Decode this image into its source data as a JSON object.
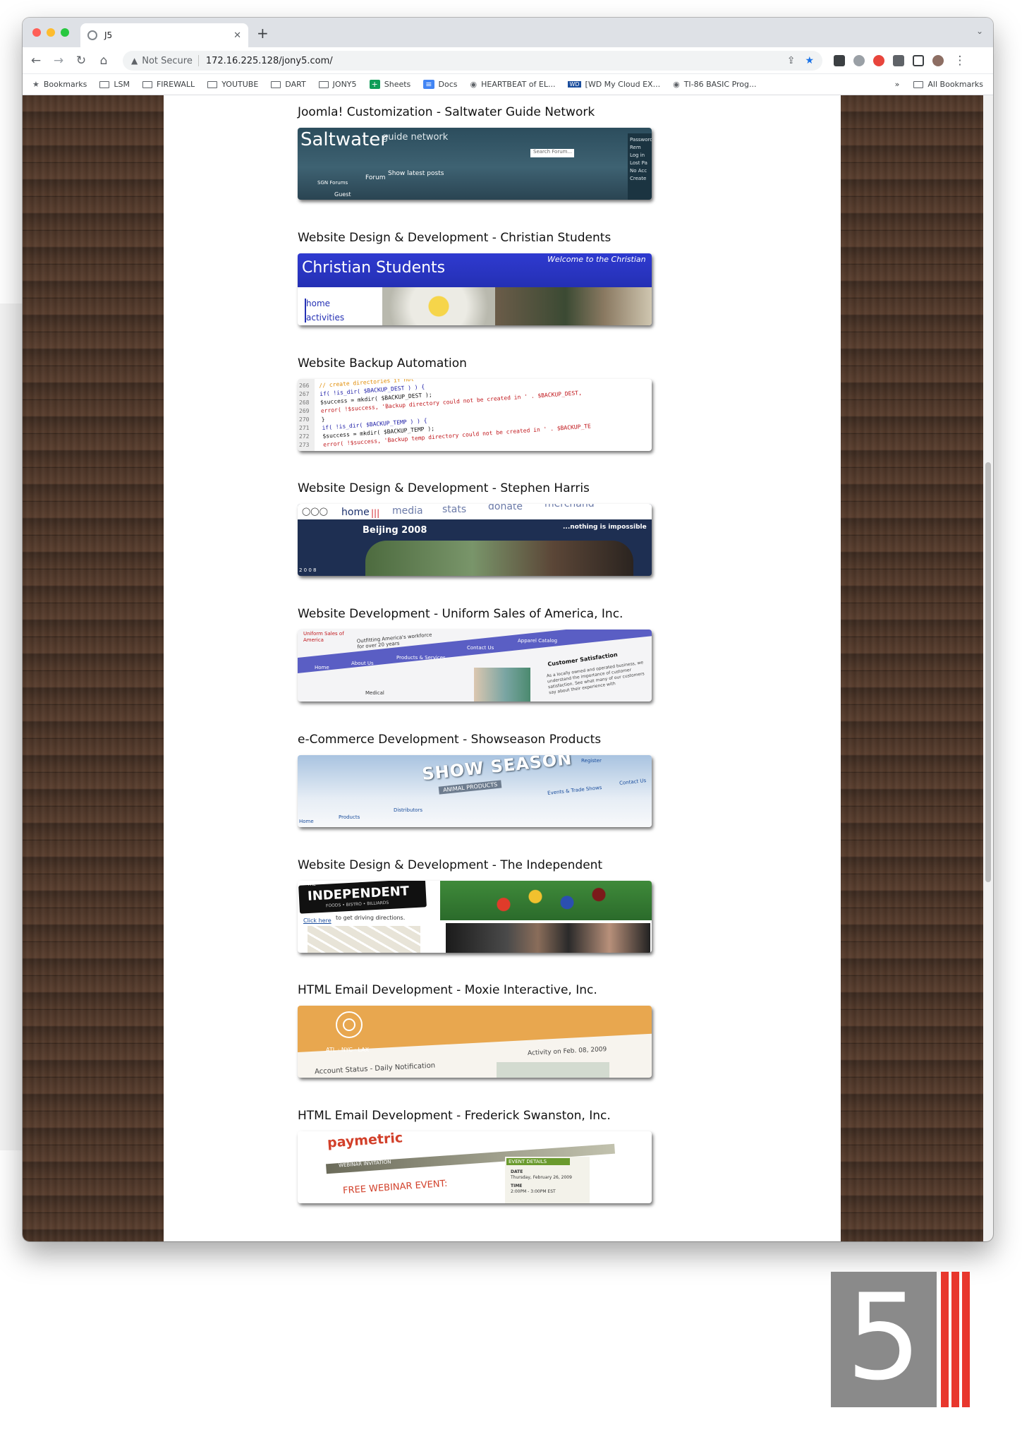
{
  "browser": {
    "tab_title": "J5",
    "security_label": "Not Secure",
    "url": "172.16.225.128/jony5.com/",
    "bookmarks": [
      {
        "label": "Bookmarks",
        "icon": "star-icon"
      },
      {
        "label": "LSM",
        "icon": "folder-icon"
      },
      {
        "label": "FIREWALL",
        "icon": "folder-icon"
      },
      {
        "label": "YOUTUBE",
        "icon": "folder-icon"
      },
      {
        "label": "DART",
        "icon": "folder-icon"
      },
      {
        "label": "JONY5",
        "icon": "folder-icon"
      },
      {
        "label": "Sheets",
        "icon": "sheets-icon"
      },
      {
        "label": "Docs",
        "icon": "docs-icon"
      },
      {
        "label": "HEARTBEAT of EL...",
        "icon": "globe-icon"
      },
      {
        "label": "[WD My Cloud EX...",
        "icon": "wd-icon"
      },
      {
        "label": "TI-86 BASIC Prog...",
        "icon": "globe-icon"
      }
    ],
    "overflow": "»",
    "all_bookmarks": "All Bookmarks"
  },
  "portfolio": [
    {
      "title": "Joomla! Customization - Saltwater Guide Network"
    },
    {
      "title": "Website Design & Development - Christian Students"
    },
    {
      "title": "Website Backup Automation"
    },
    {
      "title": "Website Design & Development - Stephen Harris"
    },
    {
      "title": "Website Development - Uniform Sales of America, Inc."
    },
    {
      "title": "e-Commerce Development - Showseason Products"
    },
    {
      "title": "Website Design & Development - The Independent"
    },
    {
      "title": "HTML Email Development - Moxie Interactive, Inc."
    },
    {
      "title": "HTML Email Development - Frederick Swanston, Inc."
    }
  ],
  "thumbs": {
    "salt": {
      "brand": "Saltwater",
      "sub": "guide network",
      "nav1": "Forum",
      "nav2": "Show latest posts",
      "search": "Search Forum...",
      "forums": "SGN Forums",
      "guest": "Guest",
      "side": [
        "Password",
        "Rem",
        "Log in",
        "Lost Pa",
        "No Acc",
        "Create"
      ]
    },
    "christ": {
      "brand": "Christian Students",
      "welcome": "Welcome to the Christian",
      "nav": [
        "home",
        "activities"
      ]
    },
    "backup": {
      "lines": [
        "266",
        "267",
        "268",
        "269",
        "270",
        "271",
        "272",
        "273"
      ],
      "code": [
        "// create directories if not",
        "if( !is_dir( $BACKUP_DEST ) ) {",
        "    $success = mkdir( $BACKUP_DEST );",
        "    error( !$success, 'Backup directory could not be created in ' . $BACKUP_DEST,",
        "}",
        "if( !is_dir( $BACKUP_TEMP ) ) {",
        "    $success = mkdir( $BACKUP_TEMP );",
        "    error( !$success, 'Backup temp directory could not be created in ' . $BACKUP_TE"
      ]
    },
    "harris": {
      "nav": [
        "home",
        "media",
        "stats",
        "donate",
        "merchand"
      ],
      "beijing": "Beijing 2008",
      "tag": "...nothing is impossible",
      "year": "2 0 0 8"
    },
    "uniform": {
      "logo": "Uniform Sales of America",
      "tagline": "Outfitting America's workforce for over 20 years",
      "nav": [
        "Home",
        "About Us",
        "Products & Services",
        "Contact Us",
        "Apparel Catalog"
      ],
      "heading": "Customer Satisfaction",
      "body": "As a locally owned and operated business, we understand the importance of customer satisfaction. See what many of our customers say about their experience with",
      "medical": "Medical"
    },
    "show": {
      "brand": "SHOW SEASON",
      "sub": "ANIMAL PRODUCTS",
      "register": "Register",
      "nav": [
        "Home",
        "Products",
        "Distributors",
        "Events & Trade Shows",
        "Contact Us"
      ]
    },
    "indep": {
      "brand": "INDEPENDENT",
      "the": "THE",
      "sub": "FOODS • BISTRO • BILLIARDS",
      "link": "Click here",
      "directions": "to get driving directions."
    },
    "moxie": {
      "cities": "ATL · NYC · LAX",
      "status": "Account Status - Daily Notification",
      "activity": "Activity on Feb. 08, 2009"
    },
    "pay": {
      "brand": "paymetric",
      "banner": "WEBINAR INVITATION",
      "headline": "FREE WEBINAR EVENT:",
      "details": "EVENT DETAILS",
      "date_label": "DATE",
      "date": "Thursday, February 26, 2009",
      "time_label": "TIME",
      "time": "2:00PM - 3:00PM EST"
    }
  },
  "logo": {
    "numeral": "5"
  }
}
